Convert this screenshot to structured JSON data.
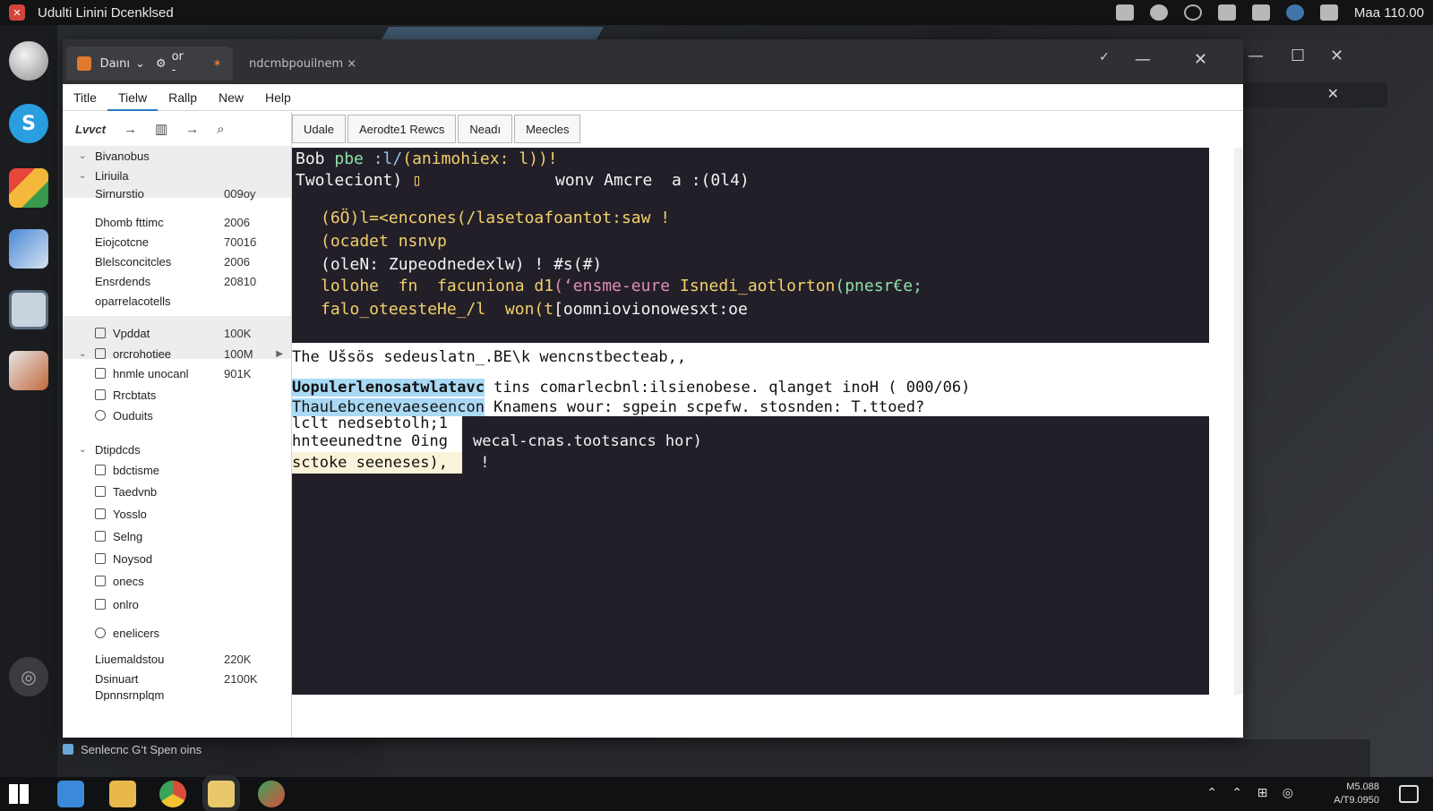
{
  "topbar": {
    "app_title": "Udulti Linini Dcenklsed",
    "clock": "Maa 110.00"
  },
  "window": {
    "tab_active": "Daını",
    "tab_active_extra": "or -",
    "tab_other": "ndcmbpouilnem ×"
  },
  "menu": [
    "Title",
    "Tielw",
    "Rallp",
    "New",
    "Help"
  ],
  "sidebar": {
    "tool_label": "Lvvct",
    "rows": [
      {
        "name": "Bivanobus",
        "size": ""
      },
      {
        "name": "Liriuila",
        "size": ""
      },
      {
        "name": "Sirnurstio",
        "size": "009oy"
      },
      {
        "name": "Dhomb fttimc",
        "size": "2006"
      },
      {
        "name": "Eiojcotcne",
        "size": "7001б"
      },
      {
        "name": "Blelsconcitcles",
        "size": "2006"
      },
      {
        "name": "Ensrdends",
        "size": "20810"
      },
      {
        "name": "oparrelacotells",
        "size": ""
      },
      {
        "name": "Vpddat",
        "size": "100K"
      },
      {
        "name": "orcrohotiee",
        "size": "100M"
      },
      {
        "name": "hnmle unocanl",
        "size": "901K"
      },
      {
        "name": "Rrcbtats",
        "size": ""
      },
      {
        "name": "Ouduits",
        "size": ""
      },
      {
        "name": "Dtipdcds",
        "size": ""
      },
      {
        "name": "bdctisme",
        "size": ""
      },
      {
        "name": "Taedvnb",
        "size": ""
      },
      {
        "name": "Yosslo",
        "size": ""
      },
      {
        "name": "Selng",
        "size": ""
      },
      {
        "name": "Noysod",
        "size": ""
      },
      {
        "name": "onecs",
        "size": ""
      },
      {
        "name": "onlro",
        "size": ""
      },
      {
        "name": "enelicers",
        "size": ""
      },
      {
        "name": "Liuemaldstou",
        "size": "220K"
      },
      {
        "name": "Dsinuart",
        "size": "2100K"
      },
      {
        "name": "Dpnnsrnplqm",
        "size": ""
      }
    ]
  },
  "toolbar_buttons": [
    "Udale",
    "Aerodte1 Rewcs",
    "Neadı",
    "Meecles"
  ],
  "terminal": {
    "line1a": "Bob ",
    "line1b": "pbe ",
    "line1c": ":l/",
    "line1d": "(animohiex: l))!",
    "line2a": "Twoleciont) ",
    "line2b": "▯",
    "line2c": "wonv Amcre  a :(0l4)",
    "line3": "(6Ö)l=<encones(/lasetoafoantot:saw !",
    "line4": "(ocadet nsnvp",
    "line5": "(oleN: Zupeodnedexlw) ! #s(#)",
    "line6a": "lolohe  fn  facuniona d1",
    "line6b": "(‘ensme-eure",
    "line6c": " Isnedi_aotlorton",
    "line6d": "(pnesr€e;",
    "line7a": "falo_oteesteHe_/l  won(t",
    "line7b": "[oomniovionowesxt:oe"
  },
  "text_area": {
    "line1": "The Ušsös sedeuslatn_.BE\\k wencnstbecteab,,",
    "line2a": "Uopulerlenosatwlatavc",
    "line2b": " tins comarlecbnl:ilsienobese. qlanget inoH ( 000/06)",
    "line3a": "ThauLebcenevaeseencon",
    "line3b": " Knamens wour: sgpein scpefw. stosnden: T.ttoed?"
  },
  "terminal2": {
    "line1": "lclt nedsebtolh;1",
    "line2a": "hnteeunedtne 0ing",
    "line2b": "wecal-cnas.tootsancs hor)",
    "line3a": "sctoke seeneses),",
    "line3b": " !"
  },
  "status": "Senlecnc G‘t Spen oins",
  "taskbar_clock": {
    "line1": "M5.088",
    "line2": "A/T9.0950"
  },
  "tray_icons": [
    "notes-icon",
    "globe-icon",
    "volume-icon",
    "network-icon",
    "wifi-icon",
    "user-icon",
    "edit-icon"
  ],
  "accent": "#2a78c8"
}
